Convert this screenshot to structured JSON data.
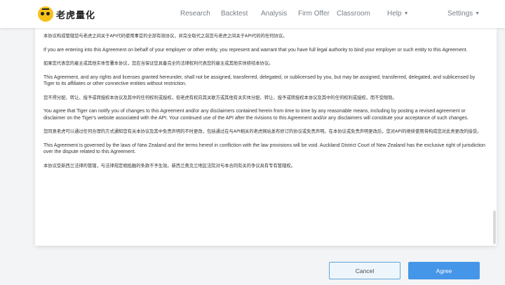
{
  "header": {
    "logo_text": "老虎量化",
    "nav": [
      {
        "label": "Research"
      },
      {
        "label": "Backtest"
      },
      {
        "label": "Analysis"
      },
      {
        "label": "Firm Offer"
      },
      {
        "label": "Classroom"
      },
      {
        "label": "Help"
      },
      {
        "label": "Settings"
      }
    ]
  },
  "agreement": {
    "paragraphs": [
      "本协议构成管辖您与老虎之间关于API代码使用事宜的全部有效协议，并完全取代之前您与老虎之间关于API代码的任何协议。",
      "If you are entering into this Agreement on behalf of your employer or other entity, you represent and warrant that you have full legal authority to bind your employer or such entity to this Agreement.",
      "如果您代表您的雇主或其他实体签署本协议，您应当保证您具备完全的法律权利代表您的雇主或其他实体缔结本协议。",
      "This Agreement, and any rights and licenses granted hereunder, shall not be assigned, transferred, delegated, or sublicensed by you, but may be assigned, transferred, delegated, and sublicensed by Tiger to its affiliates or other connective entities without restriction.",
      "您不得分配、转让、授予或转授权本协议及其中的任何权利或授权，但老虎有权向其关联方或其他有关实体分配、转让、授予或转授权本协议及其中的任何权利或授权，而不受限制。",
      "You agree that Tiger can notify you of changes to this Agreement and/or any disclaimers contained herein from time to time by any reasonable means, including by posting a revised agreement or disclaimer on the Tiger's website associated with the API. Your continued use of the API after the rivisions to this Agreement and/or any disclaimers will constitute your acceptance of such changes.",
      "您同意老虎可以通过任何合理的方式通知您有关本协议及其中免责声明的不时更改，包括通过在与API相关的老虎网站发布修订的协议或免责声明。在本协议或免责声明更改后，您对API的继续使用将构成您对此类更改的接受。",
      "This Agreement is governed by the laws of New Zealand and the terms hereof in confliction with the law provisions will be void. Auckland District Court of New Zealand has the exclusive right of jurisdiction over the dispute related to this Agreement.",
      "本协议受新西兰法律的管辖，与法律规定相抵触的条款不予生效。新西兰奥克兰地区法院对与本合同有关的争议具有专有管辖权。"
    ]
  },
  "actions": {
    "cancel_label": "Cancel",
    "agree_label": "Agree"
  },
  "icons": {
    "logo": "tiger-face-icon",
    "dropdown": "caret-down-icon"
  },
  "colors": {
    "primary": "#4596e8",
    "logo_yellow": "#f6c21a"
  }
}
